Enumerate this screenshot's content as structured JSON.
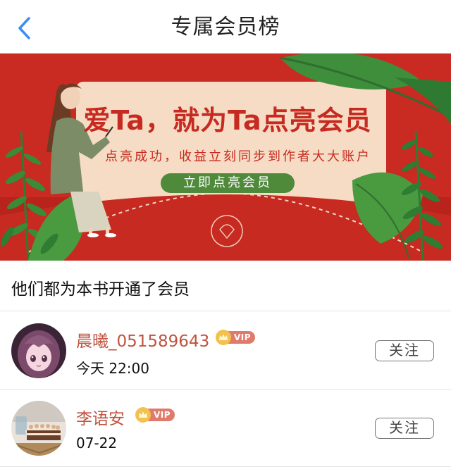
{
  "header": {
    "title": "专属会员榜",
    "back_icon": "chevron-left-icon"
  },
  "banner": {
    "headline": "爱Ta，就为Ta点亮会员",
    "subtitle": "点亮成功，收益立刻同步到作者大大账户",
    "cta_label": "立即点亮会员",
    "colors": {
      "background": "#c92a22",
      "card": "#f6dcc4",
      "accent_green": "#4f8a3a",
      "text_red": "#c62a20"
    }
  },
  "section": {
    "heading": "他们都为本书开通了会员"
  },
  "members": [
    {
      "name": "晨曦_051589643",
      "badge": "VIP",
      "time": "今天 22:00",
      "follow_label": "关注",
      "avatar_icon": "anime-girl-avatar"
    },
    {
      "name": "李语安",
      "badge": "VIP",
      "time": "07-22",
      "follow_label": "关注",
      "avatar_icon": "cake-photo-avatar"
    }
  ]
}
